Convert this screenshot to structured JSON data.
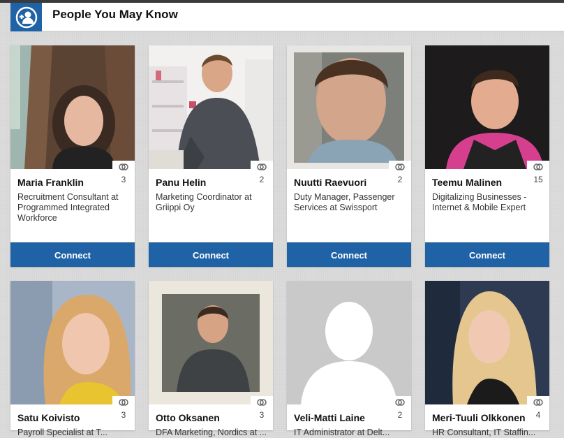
{
  "section": {
    "title": "People You May Know",
    "icon": "add-person-icon",
    "accent": "#1f63a6"
  },
  "people": [
    {
      "name": "Maria Franklin",
      "headline": "Recruitment Consultant at Programmed Integrated Workforce",
      "shared": "3",
      "connect": "Connect"
    },
    {
      "name": "Panu Helin",
      "headline": "Marketing Coordinator at Griippi Oy",
      "shared": "2",
      "connect": "Connect"
    },
    {
      "name": "Nuutti Raevuori",
      "headline": "Duty Manager, Passenger Services at Swissport",
      "shared": "2",
      "connect": "Connect"
    },
    {
      "name": "Teemu Malinen",
      "headline": "Digitalizing Businesses - Internet & Mobile Expert",
      "shared": "15",
      "connect": "Connect"
    },
    {
      "name": "Satu Koivisto",
      "headline": "Payroll Specialist at T...",
      "shared": "3"
    },
    {
      "name": "Otto Oksanen",
      "headline": "DFA Marketing, Nordics at ...",
      "shared": "3"
    },
    {
      "name": "Veli-Matti Laine",
      "headline": "IT Administrator at Delt...",
      "shared": "2"
    },
    {
      "name": "Meri-Tuuli Olkkonen",
      "headline": "HR Consultant, IT Staffin...",
      "shared": "4"
    }
  ]
}
